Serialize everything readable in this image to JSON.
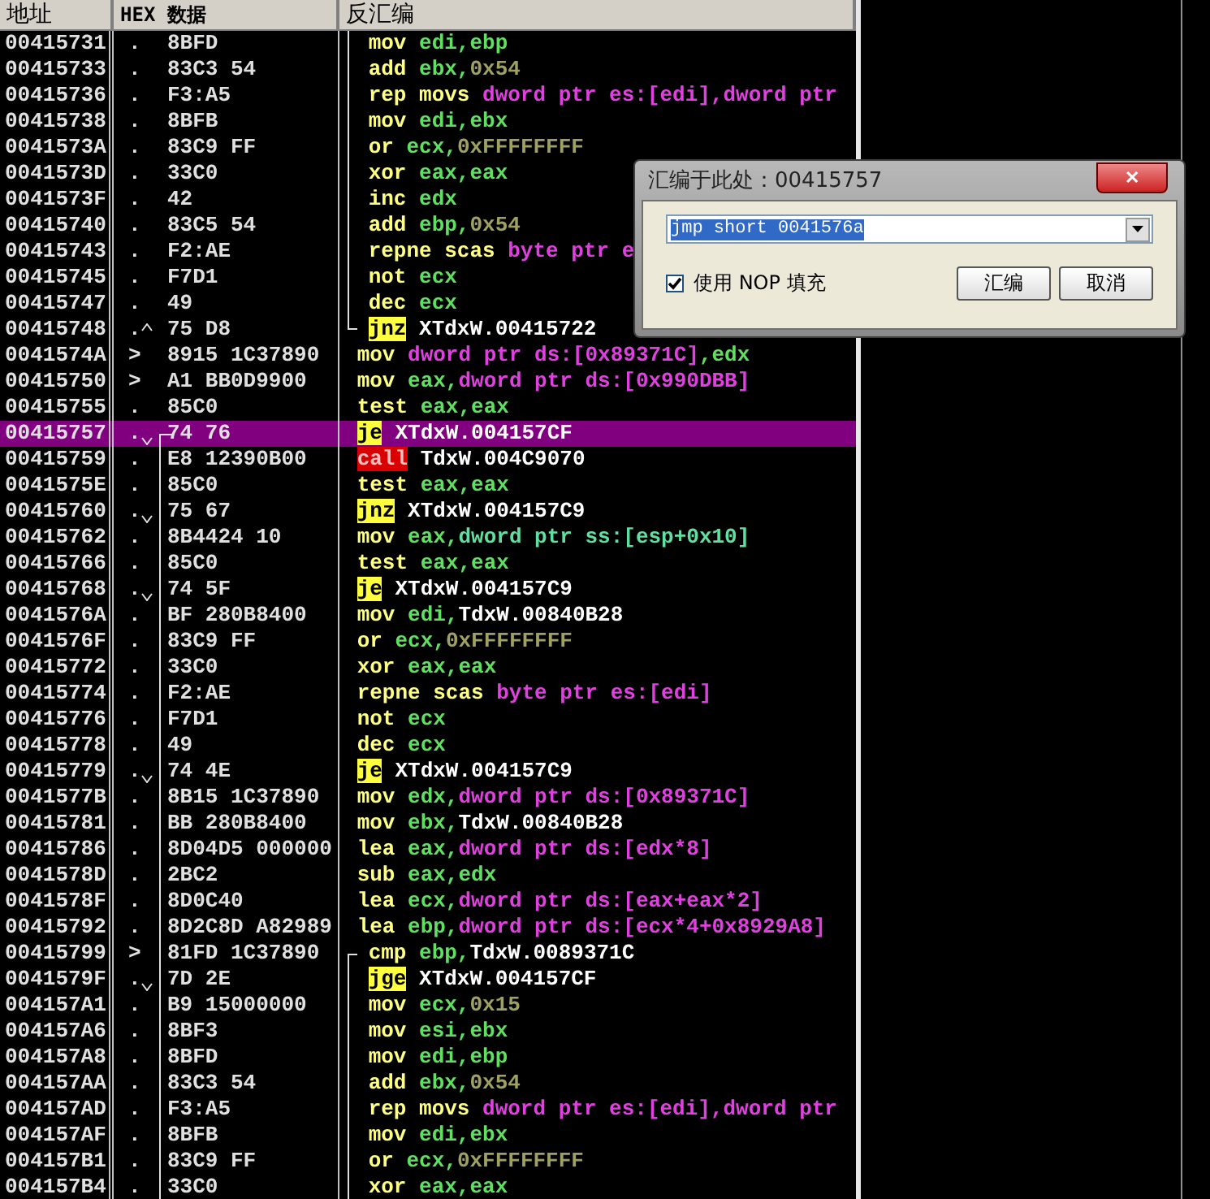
{
  "columns": [
    {
      "label": "地址"
    },
    {
      "label": "HEX 数据"
    },
    {
      "label": "反汇编"
    }
  ],
  "rows": [
    {
      "addr": "00415731",
      "mark": ".",
      "hex": "8BFD",
      "arrow_up": false,
      "arrow_down": false,
      "jump_line": false,
      "loop_line": true,
      "selected": false,
      "parts": [
        {
          "text": "mov",
          "kind": "op"
        },
        {
          "text": "edi,ebp",
          "kind": "reg"
        }
      ]
    },
    {
      "addr": "00415733",
      "mark": ".",
      "hex": "83C3 54",
      "arrow_up": false,
      "arrow_down": false,
      "jump_line": false,
      "loop_line": true,
      "selected": false,
      "parts": [
        {
          "text": "add",
          "kind": "op"
        },
        {
          "text": "ebx,",
          "kind": "reg"
        },
        {
          "text": "0x54",
          "kind": "imm"
        }
      ]
    },
    {
      "addr": "00415736",
      "mark": ".",
      "hex": "F3:A5",
      "arrow_up": false,
      "arrow_down": false,
      "jump_line": false,
      "loop_line": true,
      "selected": false,
      "parts": [
        {
          "text": "rep movs",
          "kind": "op"
        },
        {
          "text": "dword ptr es:[edi],dword ptr",
          "kind": "mem"
        }
      ]
    },
    {
      "addr": "00415738",
      "mark": ".",
      "hex": "8BFB",
      "arrow_up": false,
      "arrow_down": false,
      "jump_line": false,
      "loop_line": true,
      "selected": false,
      "parts": [
        {
          "text": "mov",
          "kind": "op"
        },
        {
          "text": "edi,ebx",
          "kind": "reg"
        }
      ]
    },
    {
      "addr": "0041573A",
      "mark": ".",
      "hex": "83C9 FF",
      "arrow_up": false,
      "arrow_down": false,
      "jump_line": false,
      "loop_line": true,
      "selected": false,
      "parts": [
        {
          "text": "or",
          "kind": "op"
        },
        {
          "text": "ecx,",
          "kind": "reg"
        },
        {
          "text": "0xFFFFFFFF",
          "kind": "imm"
        }
      ]
    },
    {
      "addr": "0041573D",
      "mark": ".",
      "hex": "33C0",
      "arrow_up": false,
      "arrow_down": false,
      "jump_line": false,
      "loop_line": true,
      "selected": false,
      "parts": [
        {
          "text": "xor",
          "kind": "op"
        },
        {
          "text": "eax,eax",
          "kind": "reg"
        }
      ]
    },
    {
      "addr": "0041573F",
      "mark": ".",
      "hex": "42",
      "arrow_up": false,
      "arrow_down": false,
      "jump_line": false,
      "loop_line": true,
      "selected": false,
      "parts": [
        {
          "text": "inc",
          "kind": "op"
        },
        {
          "text": "edx",
          "kind": "reg"
        }
      ]
    },
    {
      "addr": "00415740",
      "mark": ".",
      "hex": "83C5 54",
      "arrow_up": false,
      "arrow_down": false,
      "jump_line": false,
      "loop_line": true,
      "selected": false,
      "parts": [
        {
          "text": "add",
          "kind": "op"
        },
        {
          "text": "ebp,",
          "kind": "reg"
        },
        {
          "text": "0x54",
          "kind": "imm"
        }
      ]
    },
    {
      "addr": "00415743",
      "mark": ".",
      "hex": "F2:AE",
      "arrow_up": false,
      "arrow_down": false,
      "jump_line": false,
      "loop_line": true,
      "selected": false,
      "parts": [
        {
          "text": "repne scas",
          "kind": "op"
        },
        {
          "text": "byte ptr e",
          "kind": "mem"
        }
      ]
    },
    {
      "addr": "00415745",
      "mark": ".",
      "hex": "F7D1",
      "arrow_up": false,
      "arrow_down": false,
      "jump_line": false,
      "loop_line": true,
      "selected": false,
      "parts": [
        {
          "text": "not",
          "kind": "op"
        },
        {
          "text": "ecx",
          "kind": "reg"
        }
      ]
    },
    {
      "addr": "00415747",
      "mark": ".",
      "hex": "49",
      "arrow_up": false,
      "arrow_down": false,
      "jump_line": false,
      "loop_line": true,
      "selected": false,
      "parts": [
        {
          "text": "dec",
          "kind": "op"
        },
        {
          "text": "ecx",
          "kind": "reg"
        }
      ]
    },
    {
      "addr": "00415748",
      "mark": ".",
      "hex": "75 D8",
      "arrow_up": true,
      "arrow_down": false,
      "jump_line": false,
      "loop_line": true,
      "selected": false,
      "parts": [
        {
          "text": "jnz",
          "kind": "jump"
        },
        {
          "text": "XTdxW.00415722",
          "kind": "sym"
        }
      ]
    },
    {
      "addr": "0041574A",
      "mark": ">",
      "hex": "8915 1C37890",
      "arrow_up": false,
      "arrow_down": false,
      "jump_line": false,
      "loop_line": false,
      "selected": false,
      "parts": [
        {
          "text": "mov",
          "kind": "op"
        },
        {
          "text": "dword ptr ds:[0x89371C]",
          "kind": "mem"
        },
        {
          "text": ",edx",
          "kind": "reg"
        }
      ]
    },
    {
      "addr": "00415750",
      "mark": ">",
      "hex": "A1 BB0D9900",
      "arrow_up": false,
      "arrow_down": false,
      "jump_line": false,
      "loop_line": false,
      "selected": false,
      "parts": [
        {
          "text": "mov",
          "kind": "op"
        },
        {
          "text": "eax,",
          "kind": "reg"
        },
        {
          "text": "dword ptr ds:[0x990DBB]",
          "kind": "mem"
        }
      ]
    },
    {
      "addr": "00415755",
      "mark": ".",
      "hex": "85C0",
      "arrow_up": false,
      "arrow_down": false,
      "jump_line": false,
      "loop_line": false,
      "selected": false,
      "parts": [
        {
          "text": "test",
          "kind": "op"
        },
        {
          "text": "eax,eax",
          "kind": "reg"
        }
      ]
    },
    {
      "addr": "00415757",
      "mark": ".",
      "hex": "74 76",
      "arrow_up": false,
      "arrow_down": true,
      "jump_line": true,
      "loop_line": false,
      "selected": true,
      "parts": [
        {
          "text": "je",
          "kind": "jump"
        },
        {
          "text": "XTdxW.004157CF",
          "kind": "sym"
        }
      ]
    },
    {
      "addr": "00415759",
      "mark": ".",
      "hex": "E8 12390B00",
      "arrow_up": false,
      "arrow_down": false,
      "jump_line": true,
      "loop_line": false,
      "selected": false,
      "parts": [
        {
          "text": "call",
          "kind": "call"
        },
        {
          "text": "TdxW.004C9070",
          "kind": "sym"
        }
      ]
    },
    {
      "addr": "0041575E",
      "mark": ".",
      "hex": "85C0",
      "arrow_up": false,
      "arrow_down": false,
      "jump_line": true,
      "loop_line": false,
      "selected": false,
      "parts": [
        {
          "text": "test",
          "kind": "op"
        },
        {
          "text": "eax,eax",
          "kind": "reg"
        }
      ]
    },
    {
      "addr": "00415760",
      "mark": ".",
      "hex": "75 67",
      "arrow_up": false,
      "arrow_down": true,
      "jump_line": true,
      "loop_line": false,
      "selected": false,
      "parts": [
        {
          "text": "jnz",
          "kind": "jump"
        },
        {
          "text": "XTdxW.004157C9",
          "kind": "sym"
        }
      ]
    },
    {
      "addr": "00415762",
      "mark": ".",
      "hex": "8B4424 10",
      "arrow_up": false,
      "arrow_down": false,
      "jump_line": true,
      "loop_line": false,
      "selected": false,
      "parts": [
        {
          "text": "mov",
          "kind": "op"
        },
        {
          "text": "eax,",
          "kind": "reg"
        },
        {
          "text": "dword ptr ss:[esp+0x10]",
          "kind": "ss"
        }
      ]
    },
    {
      "addr": "00415766",
      "mark": ".",
      "hex": "85C0",
      "arrow_up": false,
      "arrow_down": false,
      "jump_line": true,
      "loop_line": false,
      "selected": false,
      "parts": [
        {
          "text": "test",
          "kind": "op"
        },
        {
          "text": "eax,eax",
          "kind": "reg"
        }
      ]
    },
    {
      "addr": "00415768",
      "mark": ".",
      "hex": "74 5F",
      "arrow_up": false,
      "arrow_down": true,
      "jump_line": true,
      "loop_line": false,
      "selected": false,
      "parts": [
        {
          "text": "je",
          "kind": "jump"
        },
        {
          "text": "XTdxW.004157C9",
          "kind": "sym"
        }
      ]
    },
    {
      "addr": "0041576A",
      "mark": ".",
      "hex": "BF 280B8400",
      "arrow_up": false,
      "arrow_down": false,
      "jump_line": true,
      "loop_line": false,
      "selected": false,
      "parts": [
        {
          "text": "mov",
          "kind": "op"
        },
        {
          "text": "edi,",
          "kind": "reg"
        },
        {
          "text": "TdxW.00840B28",
          "kind": "sym"
        }
      ]
    },
    {
      "addr": "0041576F",
      "mark": ".",
      "hex": "83C9 FF",
      "arrow_up": false,
      "arrow_down": false,
      "jump_line": true,
      "loop_line": false,
      "selected": false,
      "parts": [
        {
          "text": "or",
          "kind": "op"
        },
        {
          "text": "ecx,",
          "kind": "reg"
        },
        {
          "text": "0xFFFFFFFF",
          "kind": "imm"
        }
      ]
    },
    {
      "addr": "00415772",
      "mark": ".",
      "hex": "33C0",
      "arrow_up": false,
      "arrow_down": false,
      "jump_line": true,
      "loop_line": false,
      "selected": false,
      "parts": [
        {
          "text": "xor",
          "kind": "op"
        },
        {
          "text": "eax,eax",
          "kind": "reg"
        }
      ]
    },
    {
      "addr": "00415774",
      "mark": ".",
      "hex": "F2:AE",
      "arrow_up": false,
      "arrow_down": false,
      "jump_line": true,
      "loop_line": false,
      "selected": false,
      "parts": [
        {
          "text": "repne scas",
          "kind": "op"
        },
        {
          "text": "byte ptr es:[edi]",
          "kind": "mem"
        }
      ]
    },
    {
      "addr": "00415776",
      "mark": ".",
      "hex": "F7D1",
      "arrow_up": false,
      "arrow_down": false,
      "jump_line": true,
      "loop_line": false,
      "selected": false,
      "parts": [
        {
          "text": "not",
          "kind": "op"
        },
        {
          "text": "ecx",
          "kind": "reg"
        }
      ]
    },
    {
      "addr": "00415778",
      "mark": ".",
      "hex": "49",
      "arrow_up": false,
      "arrow_down": false,
      "jump_line": true,
      "loop_line": false,
      "selected": false,
      "parts": [
        {
          "text": "dec",
          "kind": "op"
        },
        {
          "text": "ecx",
          "kind": "reg"
        }
      ]
    },
    {
      "addr": "00415779",
      "mark": ".",
      "hex": "74 4E",
      "arrow_up": false,
      "arrow_down": true,
      "jump_line": true,
      "loop_line": false,
      "selected": false,
      "parts": [
        {
          "text": "je",
          "kind": "jump"
        },
        {
          "text": "XTdxW.004157C9",
          "kind": "sym"
        }
      ]
    },
    {
      "addr": "0041577B",
      "mark": ".",
      "hex": "8B15 1C37890",
      "arrow_up": false,
      "arrow_down": false,
      "jump_line": true,
      "loop_line": false,
      "selected": false,
      "parts": [
        {
          "text": "mov",
          "kind": "op"
        },
        {
          "text": "edx,",
          "kind": "reg"
        },
        {
          "text": "dword ptr ds:[0x89371C]",
          "kind": "mem"
        }
      ]
    },
    {
      "addr": "00415781",
      "mark": ".",
      "hex": "BB 280B8400",
      "arrow_up": false,
      "arrow_down": false,
      "jump_line": true,
      "loop_line": false,
      "selected": false,
      "parts": [
        {
          "text": "mov",
          "kind": "op"
        },
        {
          "text": "ebx,",
          "kind": "reg"
        },
        {
          "text": "TdxW.00840B28",
          "kind": "sym"
        }
      ]
    },
    {
      "addr": "00415786",
      "mark": ".",
      "hex": "8D04D5 000000",
      "arrow_up": false,
      "arrow_down": false,
      "jump_line": true,
      "loop_line": false,
      "selected": false,
      "parts": [
        {
          "text": "lea",
          "kind": "op"
        },
        {
          "text": "eax,",
          "kind": "reg"
        },
        {
          "text": "dword ptr ds:[edx*8]",
          "kind": "mem"
        }
      ]
    },
    {
      "addr": "0041578D",
      "mark": ".",
      "hex": "2BC2",
      "arrow_up": false,
      "arrow_down": false,
      "jump_line": true,
      "loop_line": false,
      "selected": false,
      "parts": [
        {
          "text": "sub",
          "kind": "op"
        },
        {
          "text": "eax,edx",
          "kind": "reg"
        }
      ]
    },
    {
      "addr": "0041578F",
      "mark": ".",
      "hex": "8D0C40",
      "arrow_up": false,
      "arrow_down": false,
      "jump_line": true,
      "loop_line": false,
      "selected": false,
      "parts": [
        {
          "text": "lea",
          "kind": "op"
        },
        {
          "text": "ecx,",
          "kind": "reg"
        },
        {
          "text": "dword ptr ds:[eax+eax*2]",
          "kind": "mem"
        }
      ]
    },
    {
      "addr": "00415792",
      "mark": ".",
      "hex": "8D2C8D A82989",
      "arrow_up": false,
      "arrow_down": false,
      "jump_line": true,
      "loop_line": false,
      "selected": false,
      "parts": [
        {
          "text": "lea",
          "kind": "op"
        },
        {
          "text": "ebp,",
          "kind": "reg"
        },
        {
          "text": "dword ptr ds:[ecx*4+0x8929A8]",
          "kind": "mem"
        }
      ]
    },
    {
      "addr": "00415799",
      "mark": ">",
      "hex": "81FD 1C37890",
      "arrow_up": false,
      "arrow_down": false,
      "jump_line": true,
      "loop_line": true,
      "selected": false,
      "parts": [
        {
          "text": "cmp",
          "kind": "op"
        },
        {
          "text": "ebp,",
          "kind": "reg"
        },
        {
          "text": "TdxW.0089371C",
          "kind": "sym"
        }
      ]
    },
    {
      "addr": "0041579F",
      "mark": ".",
      "hex": "7D 2E",
      "arrow_up": false,
      "arrow_down": true,
      "jump_line": true,
      "loop_line": true,
      "selected": false,
      "parts": [
        {
          "text": "jge",
          "kind": "jump"
        },
        {
          "text": "XTdxW.004157CF",
          "kind": "sym"
        }
      ]
    },
    {
      "addr": "004157A1",
      "mark": ".",
      "hex": "B9 15000000",
      "arrow_up": false,
      "arrow_down": false,
      "jump_line": true,
      "loop_line": true,
      "selected": false,
      "parts": [
        {
          "text": "mov",
          "kind": "op"
        },
        {
          "text": "ecx,",
          "kind": "reg"
        },
        {
          "text": "0x15",
          "kind": "imm"
        }
      ]
    },
    {
      "addr": "004157A6",
      "mark": ".",
      "hex": "8BF3",
      "arrow_up": false,
      "arrow_down": false,
      "jump_line": true,
      "loop_line": true,
      "selected": false,
      "parts": [
        {
          "text": "mov",
          "kind": "op"
        },
        {
          "text": "esi,ebx",
          "kind": "reg"
        }
      ]
    },
    {
      "addr": "004157A8",
      "mark": ".",
      "hex": "8BFD",
      "arrow_up": false,
      "arrow_down": false,
      "jump_line": true,
      "loop_line": true,
      "selected": false,
      "parts": [
        {
          "text": "mov",
          "kind": "op"
        },
        {
          "text": "edi,ebp",
          "kind": "reg"
        }
      ]
    },
    {
      "addr": "004157AA",
      "mark": ".",
      "hex": "83C3 54",
      "arrow_up": false,
      "arrow_down": false,
      "jump_line": true,
      "loop_line": true,
      "selected": false,
      "parts": [
        {
          "text": "add",
          "kind": "op"
        },
        {
          "text": "ebx,",
          "kind": "reg"
        },
        {
          "text": "0x54",
          "kind": "imm"
        }
      ]
    },
    {
      "addr": "004157AD",
      "mark": ".",
      "hex": "F3:A5",
      "arrow_up": false,
      "arrow_down": false,
      "jump_line": true,
      "loop_line": true,
      "selected": false,
      "parts": [
        {
          "text": "rep movs",
          "kind": "op"
        },
        {
          "text": "dword ptr es:[edi],dword ptr",
          "kind": "mem"
        }
      ]
    },
    {
      "addr": "004157AF",
      "mark": ".",
      "hex": "8BFB",
      "arrow_up": false,
      "arrow_down": false,
      "jump_line": true,
      "loop_line": true,
      "selected": false,
      "parts": [
        {
          "text": "mov",
          "kind": "op"
        },
        {
          "text": "edi,ebx",
          "kind": "reg"
        }
      ]
    },
    {
      "addr": "004157B1",
      "mark": ".",
      "hex": "83C9 FF",
      "arrow_up": false,
      "arrow_down": false,
      "jump_line": true,
      "loop_line": true,
      "selected": false,
      "parts": [
        {
          "text": "or",
          "kind": "op"
        },
        {
          "text": "ecx,",
          "kind": "reg"
        },
        {
          "text": "0xFFFFFFFF",
          "kind": "imm"
        }
      ]
    },
    {
      "addr": "004157B4",
      "mark": ".",
      "hex": "33C0",
      "arrow_up": false,
      "arrow_down": false,
      "jump_line": true,
      "loop_line": true,
      "selected": false,
      "parts": [
        {
          "text": "xor",
          "kind": "op"
        },
        {
          "text": "eax,eax",
          "kind": "reg"
        }
      ]
    }
  ],
  "dialog": {
    "title": "汇编于此处：00415757",
    "close": "✕",
    "command": {
      "value": "jmp short 0041576a",
      "selected": true
    },
    "checkbox": {
      "label": "使用 NOP 填充",
      "checked": true
    },
    "buttons": [
      "汇编",
      "取消"
    ]
  }
}
